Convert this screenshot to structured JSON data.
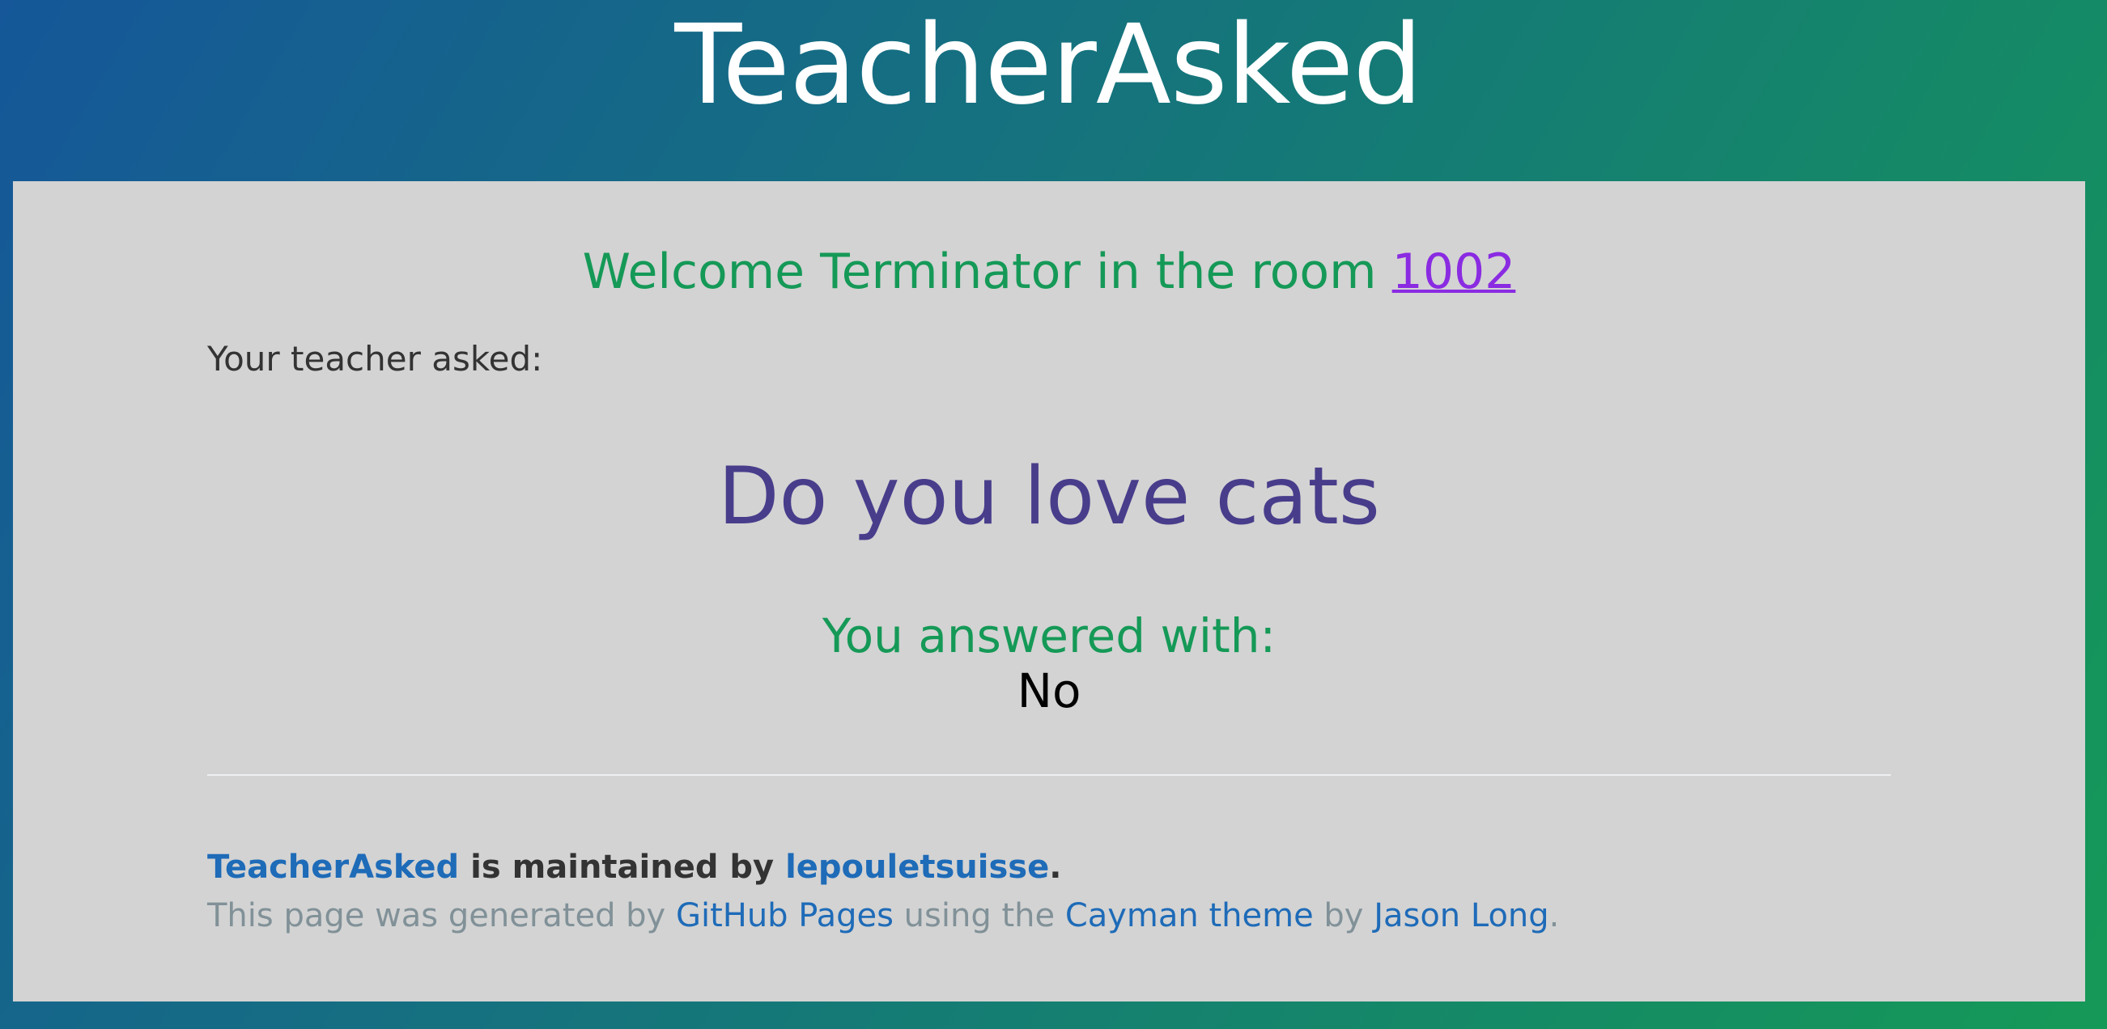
{
  "header": {
    "title": "TeacherAsked"
  },
  "main": {
    "welcome_prefix": "Welcome Terminator in the room ",
    "room_number": "1002",
    "asked_label": "Your teacher asked:",
    "question": "Do you love cats",
    "answer_label": "You answered with:",
    "answer_value": "No"
  },
  "footer": {
    "owner_project_link": "TeacherAsked",
    "owner_middle": " is maintained by ",
    "owner_user_link": "lepouletsuisse",
    "owner_end": ".",
    "credits_prefix": "This page was generated by ",
    "credits_pages_link": "GitHub Pages",
    "credits_using": " using the ",
    "credits_theme_link": "Cayman theme",
    "credits_by": " by ",
    "credits_author_link": "Jason Long",
    "credits_end": "."
  },
  "colors": {
    "gradient_start": "#155799",
    "gradient_end": "#159957",
    "panel_bg": "#d3d3d3",
    "welcome": "#159957",
    "room_link": "#8a2be2",
    "question": "#483d8b",
    "link": "#1e6bb8"
  }
}
